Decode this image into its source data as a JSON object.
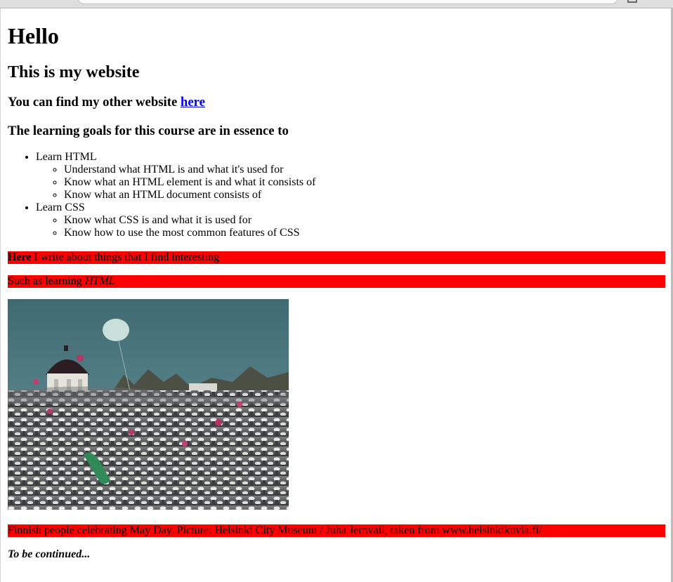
{
  "page": {
    "heading": "Hello",
    "subheading": "This is my website",
    "other_site": {
      "prefix": "You can find my other website ",
      "link_label": "here"
    },
    "goals_heading": "The learning goals for this course are in essence to",
    "goals": [
      {
        "label": "Learn HTML",
        "items": [
          "Understand what HTML is and what it's used for",
          "Know what an HTML element is and what it consists of",
          "Know what an HTML document consists of"
        ]
      },
      {
        "label": "Learn CSS",
        "items": [
          "Know what CSS is and what it is used for",
          "Know how to use the most common features of CSS"
        ]
      }
    ],
    "intro": {
      "bold": "Here",
      "rest": " I write about things that I find interesting"
    },
    "learning": {
      "text": "Such as learning ",
      "italic": "HTML"
    },
    "image_caption": "Finnish people celebrating May Day. Picture: Helsinki City Museum / Juha Jernvall, taken from www.helsinkikuvia.fi/",
    "closing": "To be continued..."
  },
  "colors": {
    "highlight": "#ff0000",
    "link": "#0000ee",
    "page_background": "#ffffff",
    "photo_sky": "#4a7a83"
  },
  "icons": {
    "browser_menu": "menu-icon"
  }
}
